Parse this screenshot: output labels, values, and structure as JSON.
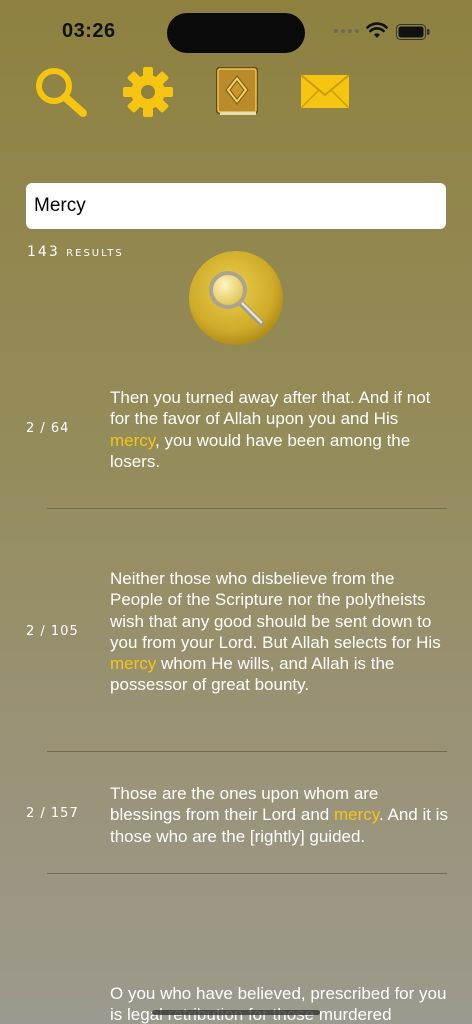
{
  "status_bar": {
    "time": "03:26"
  },
  "toolbar": {
    "tabs": [
      {
        "name": "search",
        "icon": "magnifier-icon"
      },
      {
        "name": "settings",
        "icon": "gear-icon"
      },
      {
        "name": "quran",
        "icon": "quran-book-icon"
      },
      {
        "name": "contact",
        "icon": "envelope-icon"
      }
    ],
    "accent_color": "#f4c518"
  },
  "search": {
    "value": "Mercy",
    "placeholder": ""
  },
  "results_count": "143 results",
  "results": [
    {
      "ref": "2 / 64",
      "before": "Then you turned away after that. And if not for the favor of Allah upon you and His ",
      "match": "mercy",
      "after": ", you would have been among the losers."
    },
    {
      "ref": "2 / 105",
      "before": "Neither those who disbelieve from the People of the Scripture nor the polytheists wish that any good should be sent down to you from your Lord. But Allah selects for His ",
      "match": "mercy",
      "after": " whom He wills, and Allah is the possessor of great bounty."
    },
    {
      "ref": "2 / 157",
      "before": "Those are the ones upon whom are blessings from their Lord and ",
      "match": "mercy",
      "after": ". And it is those who are the [rightly] guided."
    },
    {
      "ref": "",
      "before": "O you who have believed, prescribed for you is legal retribution for those murdered",
      "match": "",
      "after": ""
    }
  ]
}
